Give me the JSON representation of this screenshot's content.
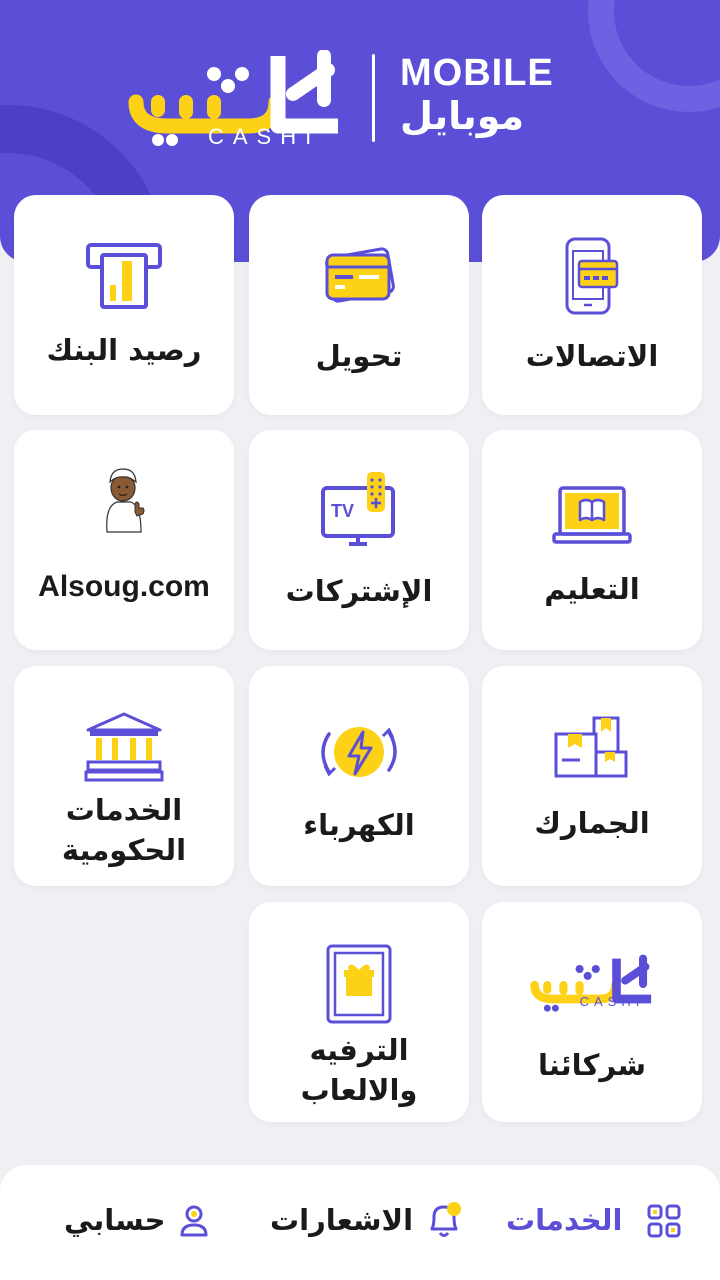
{
  "header": {
    "logo_arabic": "كاشي",
    "logo_latin": "CASHI",
    "mobile_en": "MOBILE",
    "mobile_ar": "موبايل"
  },
  "colors": {
    "brand_purple": "#5a4fd6",
    "accent_yellow": "#fcd116",
    "icon_purple": "#5b4fd8",
    "text_dark": "#1a1a1a",
    "background": "#efeff4"
  },
  "services": [
    {
      "label": "الاتصالات",
      "icon": "mobile-card-icon"
    },
    {
      "label": "تحويل",
      "icon": "transfer-card-icon"
    },
    {
      "label": "رصيد البنك",
      "icon": "atm-icon"
    },
    {
      "label": "التعليم",
      "icon": "laptop-book-icon"
    },
    {
      "label": "الإشتركات",
      "icon": "tv-remote-icon"
    },
    {
      "label": "Alsoug.com",
      "icon": "alsoug-mascot-icon"
    },
    {
      "label": "الجمارك",
      "icon": "boxes-icon"
    },
    {
      "label": "الكهرباء",
      "icon": "electricity-icon"
    },
    {
      "label": "الخدمات الحكومية",
      "icon": "government-building-icon"
    },
    {
      "label": "شركائنا",
      "icon": "cashi-logo-icon"
    },
    {
      "label": "الترفيه والالعاب",
      "icon": "gift-card-icon"
    }
  ],
  "partners_logo": {
    "arabic": "كاشي",
    "latin": "CASHI"
  },
  "tabbar": {
    "services": "الخدمات",
    "notifications": "الاشعارات",
    "account": "حسابي"
  }
}
